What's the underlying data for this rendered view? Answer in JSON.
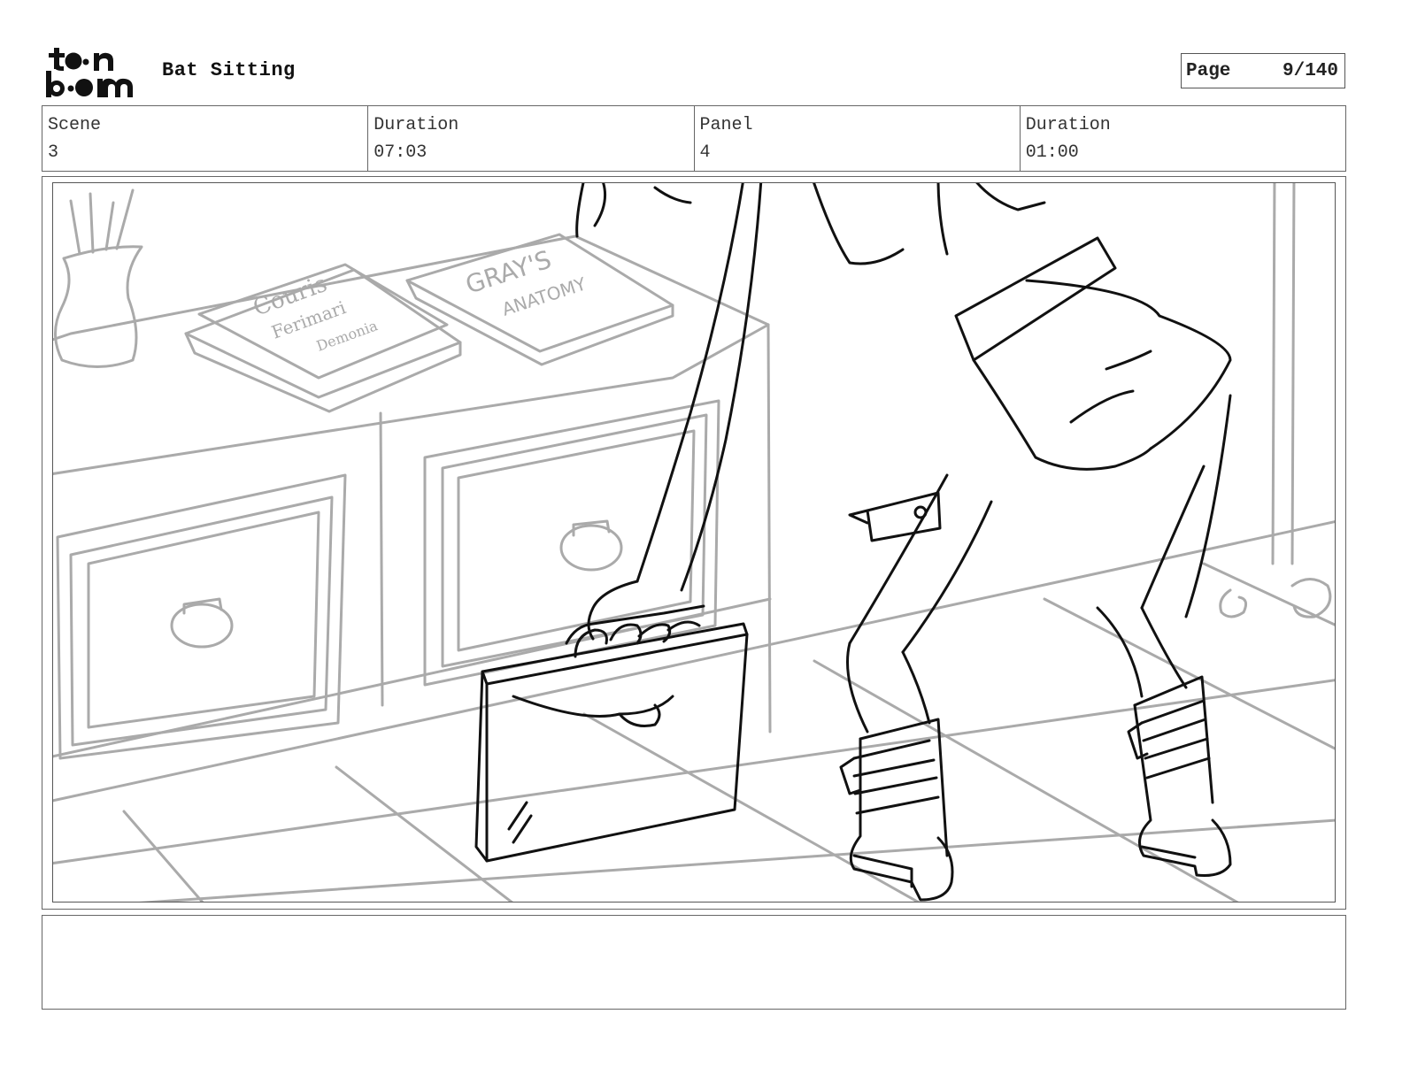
{
  "header": {
    "logo_alt": "toon boom",
    "title": "Bat Sitting",
    "page_label": "Page",
    "page_value": "9/140"
  },
  "info": {
    "scene_label": "Scene",
    "scene_value": "3",
    "scene_duration_label": "Duration",
    "scene_duration_value": "07:03",
    "panel_label": "Panel",
    "panel_value": "4",
    "panel_duration_label": "Duration",
    "panel_duration_value": "01:00"
  },
  "sketch": {
    "book1_line1": "Couris",
    "book1_line2": "Ferimari",
    "book1_line3": "Demonia",
    "book2_line1": "GRAY'S",
    "book2_line2": "ANATOMY"
  },
  "notes": {
    "text": ""
  }
}
